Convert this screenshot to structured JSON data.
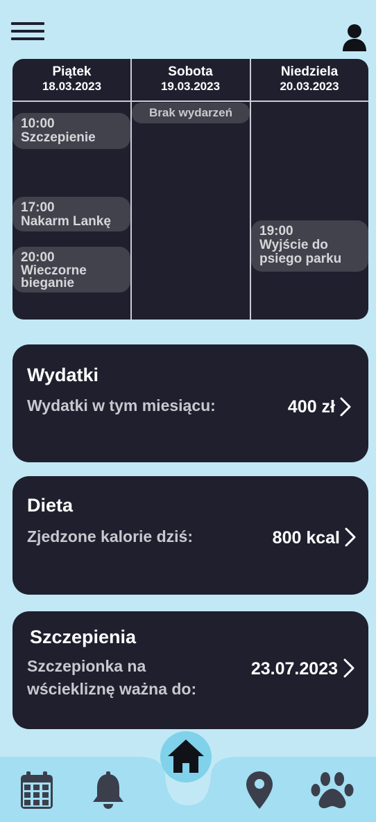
{
  "header": {
    "menu_icon": "hamburger-menu-icon",
    "profile_icon": "user-icon"
  },
  "calendar": {
    "days": [
      {
        "name": "Piątek",
        "date": "18.03.2023",
        "events": [
          {
            "time": "10:00",
            "title": "Szczepienie"
          },
          {
            "time": "17:00",
            "title": "Nakarm Lankę"
          },
          {
            "time": "20:00",
            "title": "Wieczorne bieganie"
          }
        ]
      },
      {
        "name": "Sobota",
        "date": "19.03.2023",
        "empty_label": "Brak wydarzeń"
      },
      {
        "name": "Niedziela",
        "date": "20.03.2023",
        "events": [
          {
            "time": "19:00",
            "title": "Wyjście do psiego parku"
          }
        ]
      }
    ]
  },
  "cards": {
    "expenses": {
      "title": "Wydatki",
      "label": "Wydatki w tym miesiącu:",
      "value": "400 zł"
    },
    "diet": {
      "title": "Dieta",
      "label": "Zjedzone kalorie dziś:",
      "value": "800 kcal"
    },
    "vaccinations": {
      "title": "Szczepienia",
      "label_line1": "Szczepionka na",
      "label_line2": "wściekliznę ważna do:",
      "value": "23.07.2023"
    }
  },
  "nav": {
    "items": [
      "calendar-icon",
      "bell-icon",
      "home-icon",
      "map-pin-icon",
      "paw-icon"
    ],
    "active": "home-icon"
  },
  "colors": {
    "background": "#c2e8f5",
    "panel": "#1f1f2e",
    "event": "#42424c",
    "nav_bar": "#a3def2",
    "active": "#7fd2ea",
    "icon": "#3b3f4b"
  }
}
